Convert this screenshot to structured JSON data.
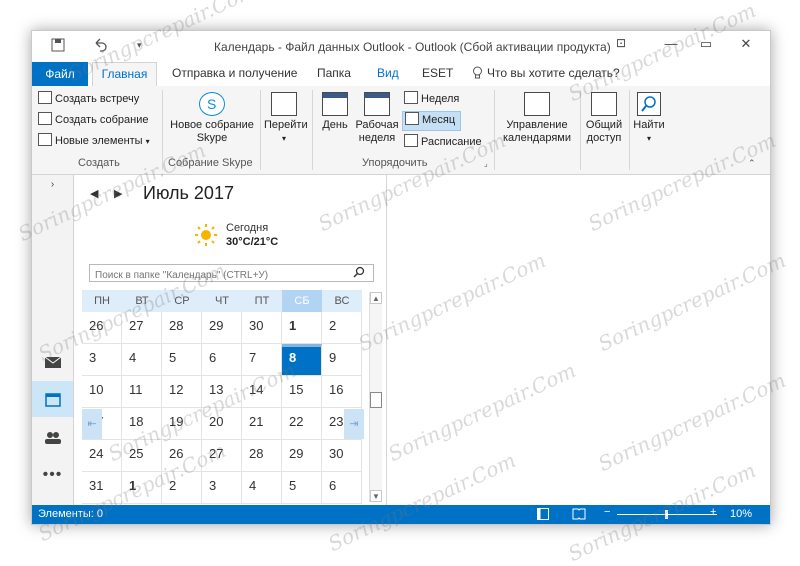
{
  "window": {
    "title": "Календарь - Файл данных Outlook - Outlook (Сбой активации продукта)",
    "minimize": "—",
    "restore": "▭",
    "close": "✕",
    "ribbon_options": "⊡"
  },
  "tabs": {
    "file": "Файл",
    "home": "Главная",
    "send_receive": "Отправка и получение",
    "folder": "Папка",
    "view": "Вид",
    "eset": "ESET",
    "tell_me": "Что вы хотите сделать?"
  },
  "ribbon": {
    "new_appointment": "Создать встречу",
    "new_meeting": "Создать собрание",
    "new_items": "Новые элементы",
    "group_create": "Создать",
    "skype_meeting": "Новое собрание Skype",
    "group_skype": "Собрание Skype",
    "go_to": "Перейти",
    "day": "День",
    "work_week": "Рабочая неделя",
    "week": "Неделя",
    "month": "Месяц",
    "schedule": "Расписание",
    "group_arrange": "Упорядочить",
    "manage_calendars": "Управление календарями",
    "share": "Общий доступ",
    "find": "Найти"
  },
  "calendar": {
    "month_title": "Июль 2017",
    "today_label": "Сегодня",
    "temperature": "30°C/21°C",
    "search_placeholder": "Поиск в папке \"Календарь\" (CTRL+У)",
    "weekdays": [
      "ПН",
      "ВТ",
      "СР",
      "ЧТ",
      "ПТ",
      "СБ",
      "ВС"
    ],
    "weeks": [
      [
        "26",
        "27",
        "28",
        "29",
        "30",
        "1",
        "2"
      ],
      [
        "3",
        "4",
        "5",
        "6",
        "7",
        "8",
        "9"
      ],
      [
        "10",
        "11",
        "12",
        "13",
        "14",
        "15",
        "16"
      ],
      [
        "17",
        "18",
        "19",
        "20",
        "21",
        "22",
        "23"
      ],
      [
        "24",
        "25",
        "26",
        "27",
        "28",
        "29",
        "30"
      ],
      [
        "31",
        "1",
        "2",
        "3",
        "4",
        "5",
        "6"
      ]
    ],
    "today_day": "8",
    "bold_days": [
      "1 июля",
      "1 августа"
    ]
  },
  "status": {
    "items": "Элементы: 0",
    "zoom": "10%"
  },
  "watermark_text": "Soringpcrepair.Com",
  "colors": {
    "accent": "#0072c6",
    "today_bg": "#0072c6",
    "weekday_header": "#ddeefa",
    "saturday_header": "#b0d4f1",
    "nav_selected": "#cde6f7"
  }
}
